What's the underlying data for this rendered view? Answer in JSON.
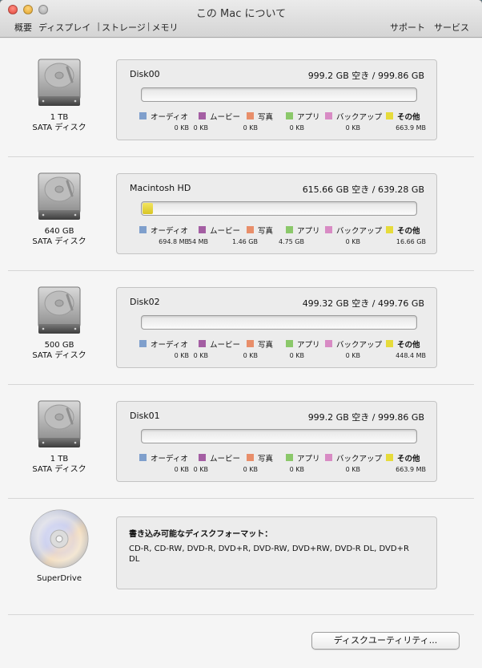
{
  "window": {
    "title": "この Mac について",
    "tabs": [
      "概要",
      "ディスプレイ",
      "ストレージ",
      "メモリ"
    ],
    "links": [
      "サポート",
      "サービス"
    ]
  },
  "legend_labels": [
    "オーディオ",
    "ムービー",
    "写真",
    "アプリ",
    "バックアップ",
    "その他"
  ],
  "legend_colors": [
    "#7f9fcc",
    "#a45ea3",
    "#e88e6a",
    "#8bc86a",
    "#d88bc4",
    "#e6db3b"
  ],
  "disks": [
    {
      "size": "1 TB",
      "type": "SATA ディスク",
      "name": "Disk00",
      "capacity": "999.2 GB 空き / 999.86 GB",
      "other_fraction": 0.0,
      "values": [
        "0 KB",
        "0 KB",
        "0 KB",
        "0 KB",
        "0 KB",
        "663.9 MB"
      ]
    },
    {
      "size": "640 GB",
      "type": "SATA ディスク",
      "name": "Macintosh HD",
      "capacity": "615.66 GB 空き / 639.28 GB",
      "other_fraction": 0.037,
      "values": [
        "694.8 MB",
        "54 MB",
        "1.46 GB",
        "4.75 GB",
        "0 KB",
        "16.66 GB"
      ]
    },
    {
      "size": "500 GB",
      "type": "SATA ディスク",
      "name": "Disk02",
      "capacity": "499.32 GB 空き / 499.76 GB",
      "other_fraction": 0.0,
      "values": [
        "0 KB",
        "0 KB",
        "0 KB",
        "0 KB",
        "0 KB",
        "448.4 MB"
      ]
    },
    {
      "size": "1 TB",
      "type": "SATA ディスク",
      "name": "Disk01",
      "capacity": "999.2 GB 空き / 999.86 GB",
      "other_fraction": 0.0,
      "values": [
        "0 KB",
        "0 KB",
        "0 KB",
        "0 KB",
        "0 KB",
        "663.9 MB"
      ]
    }
  ],
  "superdrive": {
    "label": "SuperDrive",
    "title": "書き込み可能なディスクフォーマット：",
    "formats": "CD-R, CD-RW, DVD-R, DVD+R, DVD-RW, DVD+RW, DVD-R DL, DVD+R DL"
  },
  "disk_utility_button": "ディスクユーティリティ..."
}
